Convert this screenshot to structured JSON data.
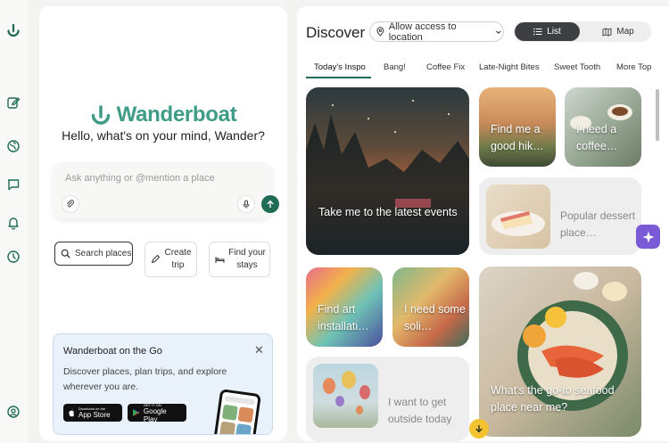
{
  "brand": {
    "name": "Wanderboat",
    "color": "#3f9c86"
  },
  "rail": {
    "icons": [
      "logo-icon",
      "edit-icon",
      "globe-icon",
      "chat-icon",
      "bell-icon",
      "history-icon",
      "user-settings-icon"
    ]
  },
  "chat": {
    "greeting": "Hello, what's on your mind, Wander?",
    "input_placeholder": "Ask anything or @mention a place",
    "actions": [
      {
        "label": "Search places",
        "icon": "search-icon"
      },
      {
        "label": "Create trip",
        "icon": "edit-icon"
      },
      {
        "label": "Find your stays",
        "icon": "bed-icon"
      }
    ],
    "promo": {
      "title": "Wanderboat on the Go",
      "description": "Discover places, plan trips, and explore wherever you are.",
      "apple_small": "Download on the",
      "apple_big": "App Store",
      "google_small": "GET IT ON",
      "google_big": "Google Play"
    }
  },
  "discover": {
    "title": "Discover",
    "location_button": "Allow access to location",
    "view_toggle": {
      "list": "List",
      "map": "Map",
      "selected": "List"
    },
    "tabs": [
      "Today's Inspo",
      "Bang!",
      "Coffee Fix",
      "Late-Night Bites",
      "Sweet Tooth",
      "More Top"
    ],
    "active_tab": "Today's Inspo",
    "cards": {
      "events": "Take me to the latest events",
      "hike": "Find me a good hik…",
      "coffee": "I need a coffee…",
      "dessert": "Popular dessert place…",
      "art": "Find art installati…",
      "solo": "I need some soli…",
      "outside": "I want to get outside today",
      "seafood": "What's the go-to seafood place near me?"
    }
  }
}
